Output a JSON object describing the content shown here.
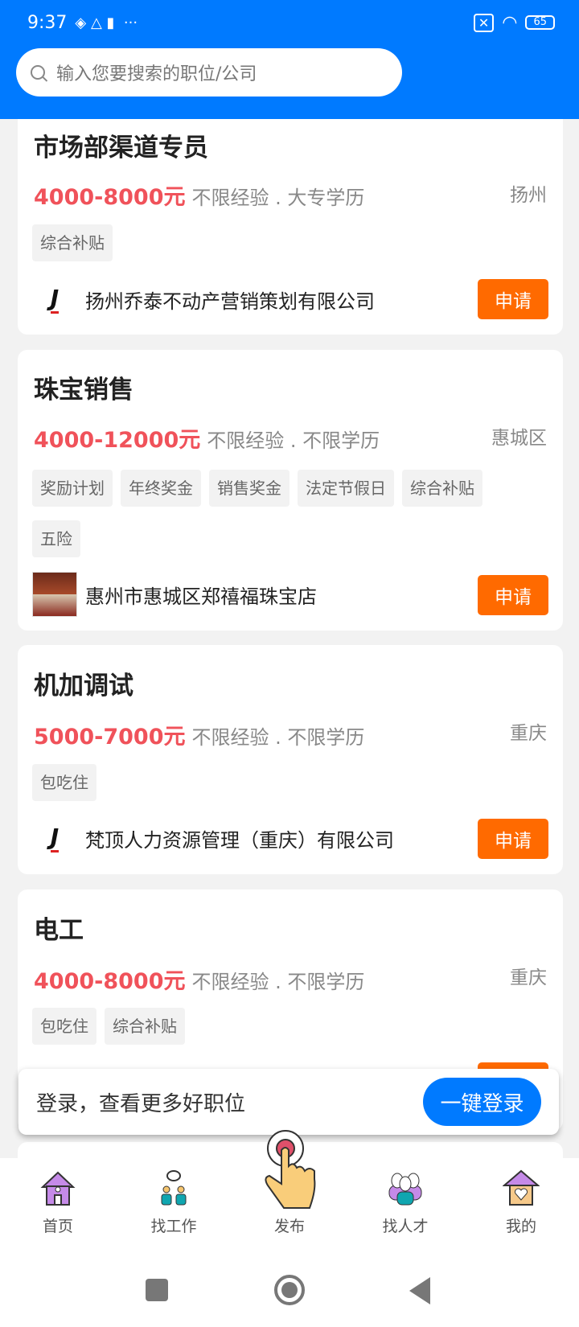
{
  "status_bar": {
    "time": "9:37",
    "battery": "65"
  },
  "search": {
    "placeholder": "输入您要搜索的职位/公司"
  },
  "jobs": [
    {
      "title": "市场部渠道专员",
      "salary": "4000-8000元",
      "requirements": "不限经验 . 大专学历",
      "location": "扬州",
      "tags": [
        "综合补贴"
      ],
      "company": "扬州乔泰不动产营销策划有限公司",
      "apply": "申请"
    },
    {
      "title": "珠宝销售",
      "salary": "4000-12000元",
      "requirements": "不限经验 . 不限学历",
      "location": "惠城区",
      "tags": [
        "奖励计划",
        "年终奖金",
        "销售奖金",
        "法定节假日",
        "综合补贴",
        "五险"
      ],
      "company": "惠州市惠城区郑禧福珠宝店",
      "apply": "申请"
    },
    {
      "title": "机加调试",
      "salary": "5000-7000元",
      "requirements": "不限经验 . 不限学历",
      "location": "重庆",
      "tags": [
        "包吃住"
      ],
      "company": "梵顶人力资源管理（重庆）有限公司",
      "apply": "申请"
    },
    {
      "title": "电工",
      "salary": "4000-8000元",
      "requirements": "不限经验 . 不限学历",
      "location": "重庆",
      "tags": [
        "包吃住",
        "综合补贴"
      ]
    }
  ],
  "login_banner": {
    "text": "登录，查看更多好职位",
    "button": "一键登录"
  },
  "tabs": [
    {
      "label": "首页",
      "icon": "home-icon"
    },
    {
      "label": "找工作",
      "icon": "find-job-icon"
    },
    {
      "label": "发布",
      "icon": "publish-icon"
    },
    {
      "label": "找人才",
      "icon": "find-talent-icon"
    },
    {
      "label": "我的",
      "icon": "profile-icon"
    }
  ],
  "colors": {
    "primary": "#007aff",
    "salary": "#f0525a",
    "apply": "#ff6a00"
  }
}
